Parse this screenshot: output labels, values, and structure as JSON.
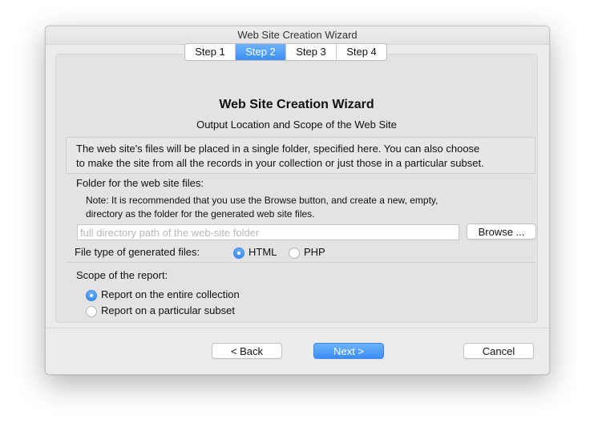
{
  "window": {
    "title": "Web Site Creation Wizard"
  },
  "tabs": [
    {
      "label": "Step 1",
      "active": false
    },
    {
      "label": "Step 2",
      "active": true
    },
    {
      "label": "Step 3",
      "active": false
    },
    {
      "label": "Step 4",
      "active": false
    }
  ],
  "content": {
    "heading": "Web Site Creation Wizard",
    "subheading": "Output Location and Scope of the Web Site",
    "info_line1": "The web site's files will be placed in a single folder, specified here. You can also choose",
    "info_line2": "to make the site from all the records in your collection or just those in a particular subset."
  },
  "folder": {
    "label": "Folder for the web site files:",
    "note_line1": "Note: It is recommended that you use the Browse button, and create a new, empty,",
    "note_line2": "directory as the folder for the generated web site files.",
    "path_value": "",
    "path_placeholder": "full directory path of the web-site folder",
    "browse_label": "Browse ..."
  },
  "file_type": {
    "label": "File type of generated files:",
    "options": [
      {
        "label": "HTML",
        "selected": true
      },
      {
        "label": "PHP",
        "selected": false
      }
    ]
  },
  "scope": {
    "label": "Scope of the report:",
    "options": [
      {
        "label": "Report on the entire collection",
        "selected": true
      },
      {
        "label": "Report on a particular subset",
        "selected": false
      }
    ]
  },
  "footer": {
    "back_label": "< Back",
    "next_label": "Next >",
    "cancel_label": "Cancel"
  },
  "colors": {
    "accent": "#3d8ff5",
    "window_bg": "#ececec",
    "panel_bg": "#e3e3e3"
  }
}
